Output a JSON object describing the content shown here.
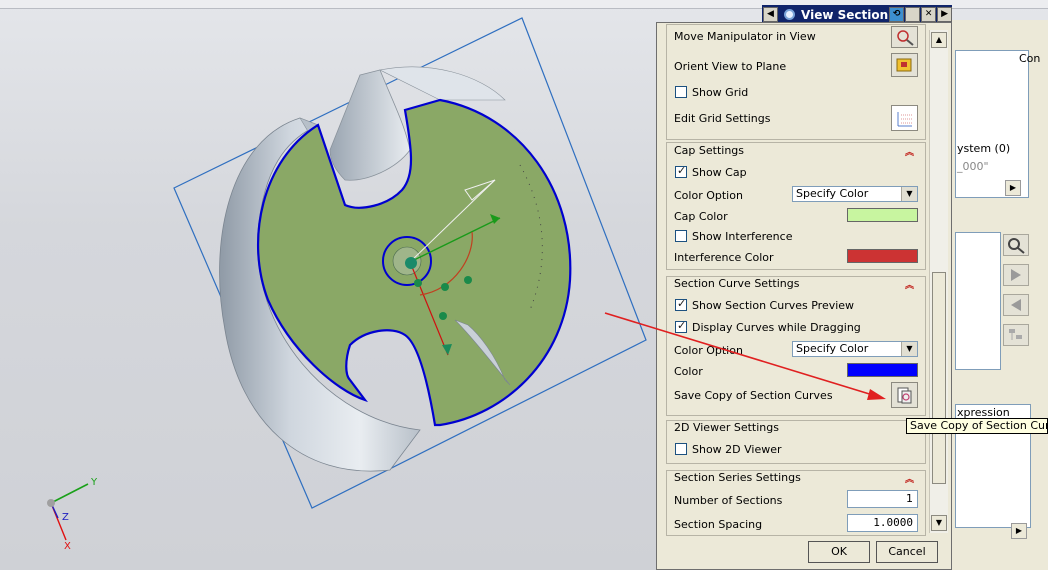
{
  "dialog": {
    "title": "View Section",
    "top_rows": {
      "move_manipulator": "Move Manipulator in View",
      "orient_view": "Orient View to Plane",
      "show_grid": "Show Grid",
      "edit_grid": "Edit Grid Settings"
    },
    "cap_settings": {
      "header": "Cap Settings",
      "show_cap": "Show Cap",
      "color_option_label": "Color Option",
      "color_option_value": "Specify Color",
      "cap_color_label": "Cap Color",
      "cap_color": "#c8f5a0",
      "show_interference": "Show Interference",
      "interference_color_label": "Interference Color",
      "interference_color": "#cc3333"
    },
    "section_curve_settings": {
      "header": "Section Curve Settings",
      "show_preview": "Show Section Curves Preview",
      "display_dragging": "Display Curves while Dragging",
      "color_option_label": "Color Option",
      "color_option_value": "Specify Color",
      "color_label": "Color",
      "color": "#0000ff",
      "save_copy": "Save Copy of Section Curves"
    },
    "viewer_2d": {
      "header": "2D Viewer Settings",
      "show_2d": "Show 2D Viewer"
    },
    "series": {
      "header": "Section Series Settings",
      "number_label": "Number of Sections",
      "number_value": "1",
      "spacing_label": "Section Spacing",
      "spacing_value": "1.0000"
    },
    "ok": "OK",
    "cancel": "Cancel"
  },
  "tooltip": "Save Copy of Section Curves",
  "background_panel": {
    "col_header": "Con",
    "system_text": "ystem (0)",
    "value_text": "_000\"",
    "expression_header": "xpression"
  },
  "triad": {
    "x": "X",
    "y": "Y",
    "z": "Z"
  },
  "colors": {
    "title_bar": "#10246a",
    "cap_face": "#8aa866",
    "section_curve": "#0000d0",
    "annotation_arrow": "#e02020"
  }
}
